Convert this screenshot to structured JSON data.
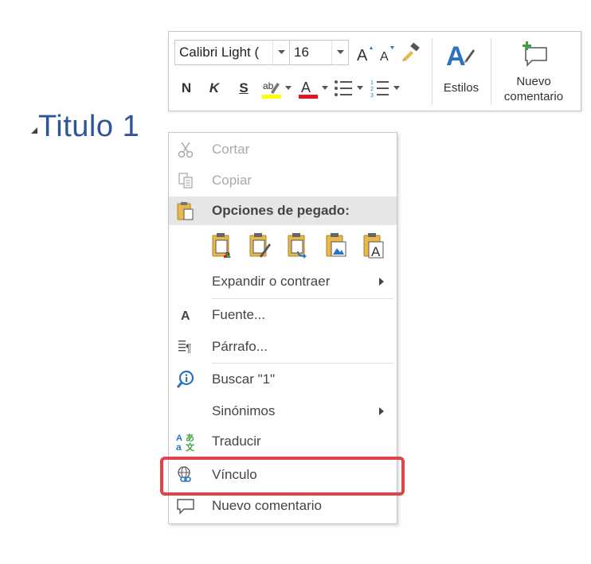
{
  "heading": {
    "text": "Titulo 1"
  },
  "mini_toolbar": {
    "font_name": "Calibri Light (",
    "font_size": "16",
    "bold_label": "N",
    "italic_label": "K",
    "underline_label": "S",
    "styles_label": "Estilos",
    "new_comment_label_line1": "Nuevo",
    "new_comment_label_line2": "comentario"
  },
  "context_menu": {
    "cut": "Cortar",
    "copy": "Copiar",
    "paste_options": "Opciones de pegado:",
    "expand_collapse": "Expandir o contraer",
    "font": "Fuente...",
    "paragraph": "Párrafo...",
    "search": "Buscar \"1\"",
    "synonyms": "Sinónimos",
    "translate": "Traducir",
    "link": "Vínculo",
    "new_comment": "Nuevo comentario"
  },
  "icons": {
    "cut": "scissors-icon",
    "copy": "copy-icon",
    "paste": "clipboard-icon",
    "font": "font-a-icon",
    "paragraph": "paragraph-icon",
    "search": "smart-lookup-icon",
    "translate": "translate-icon",
    "link": "link-icon",
    "comment": "comment-icon"
  },
  "colors": {
    "heading": "#2e5597",
    "highlight_border": "#e2434b",
    "text_highlight": "#ffff00",
    "font_color": "#e81123",
    "accent_blue": "#2b73c2",
    "green": "#3ea33e"
  }
}
